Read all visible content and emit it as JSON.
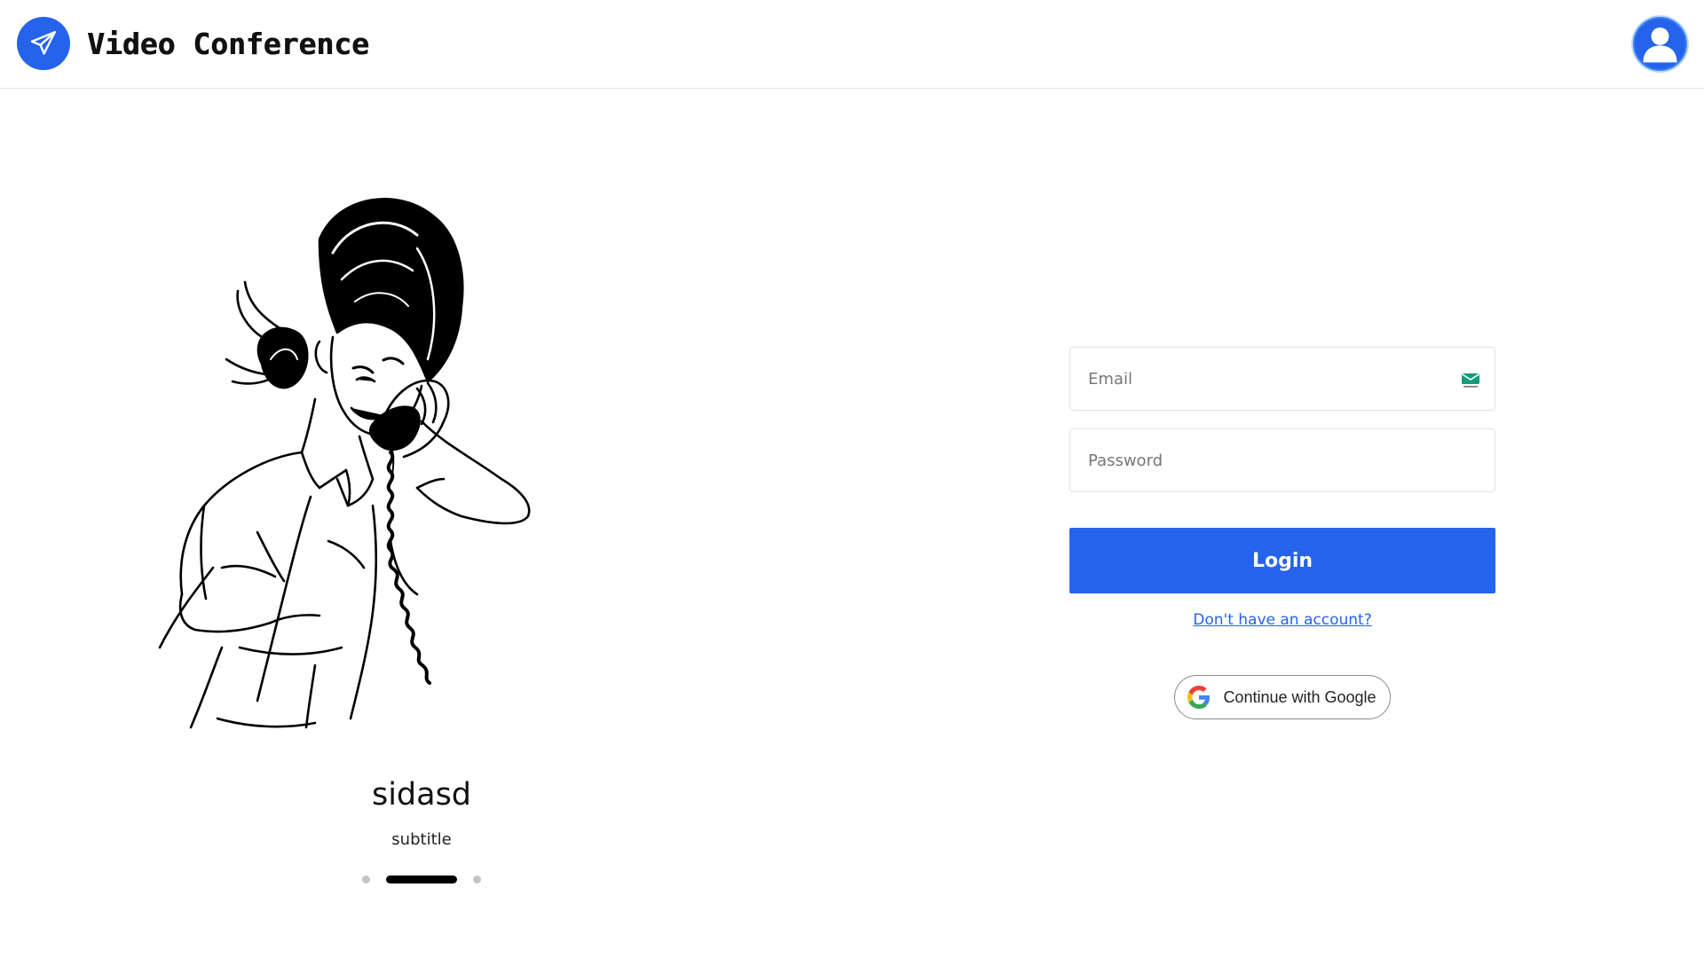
{
  "header": {
    "title": "Video Conference",
    "logo_icon": "paper-plane-icon",
    "avatar_icon": "user-avatar-icon",
    "accent_color": "#2563eb"
  },
  "carousel": {
    "slide_title": "sidasd",
    "slide_subtitle": "subtitle",
    "illustration": "woman-on-telephone-line-art",
    "slide_count": 3,
    "active_slide_index": 1
  },
  "login": {
    "email_placeholder": "Email",
    "email_icon": "email-envelope-icon",
    "password_placeholder": "Password",
    "login_label": "Login",
    "signup_link": "Don't have an account?",
    "google_label": "Continue with Google",
    "google_icon": "google-g-icon"
  }
}
